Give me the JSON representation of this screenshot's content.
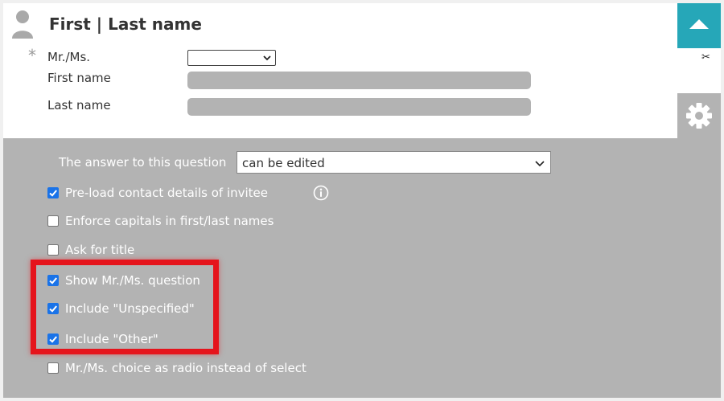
{
  "question": {
    "title": "First | Last name",
    "required_marker": "*",
    "title_field_label": "Mr./Ms.",
    "first_name_label": "First name",
    "last_name_label": "Last name",
    "title_select_value": ""
  },
  "icons": {
    "person": "person-icon",
    "collapse": "triangle-up-icon",
    "scissors": "scissors-icon",
    "gear": "gear-icon",
    "info": "info-icon",
    "scissors_glyph": "✂"
  },
  "colors": {
    "accent": "#26a7b8",
    "panel": "#b3b3b3",
    "checkbox": "#1a73e8",
    "highlight": "#e5141c"
  },
  "settings": {
    "answer_label": "The answer to this question",
    "answer_value": "can be edited",
    "options": {
      "preload": {
        "label": "Pre-load contact details of invitee",
        "checked": true
      },
      "caps": {
        "label": "Enforce capitals in first/last names",
        "checked": false
      },
      "title": {
        "label": "Ask for title",
        "checked": false
      },
      "show_mr": {
        "label": "Show Mr./Ms. question",
        "checked": true
      },
      "unspecified": {
        "label": "Include \"Unspecified\"",
        "checked": true
      },
      "other": {
        "label": "Include \"Other\"",
        "checked": true
      },
      "radio": {
        "label": "Mr./Ms. choice as radio instead of select",
        "checked": false
      }
    }
  }
}
